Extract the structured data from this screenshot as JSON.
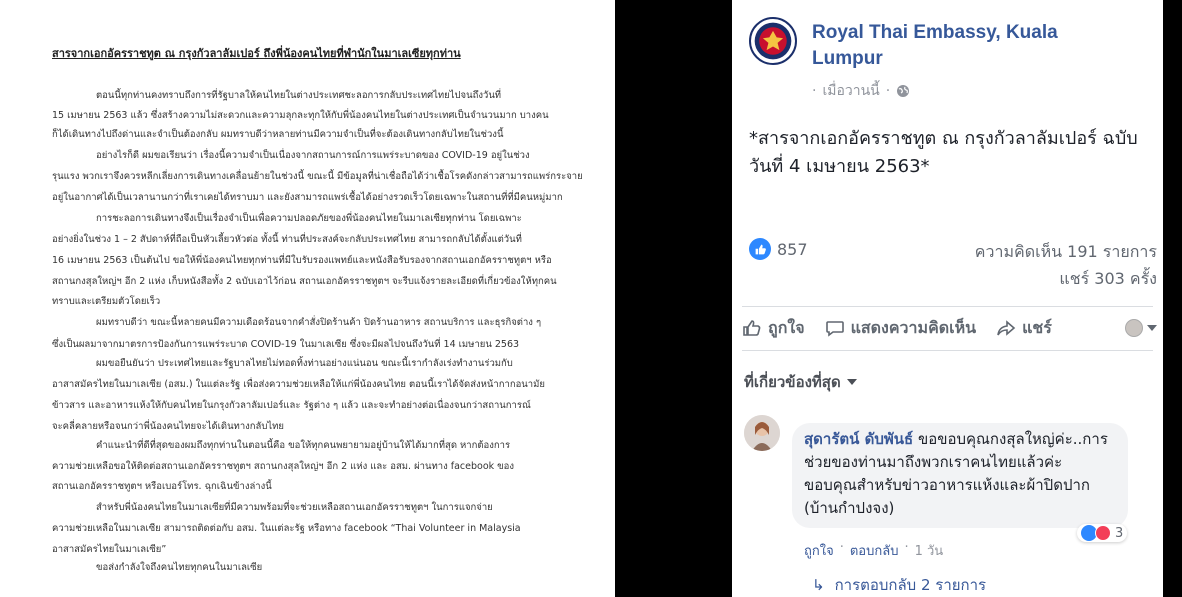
{
  "document": {
    "title": "สารจากเอกอัครราชทูต ณ กรุงกัวลาลัมเปอร์ ถึงพี่น้องคนไทยที่พำนักในมาเลเซียทุกท่าน",
    "lines": [
      "ตอนนี้ทุกท่านคงทราบถึงการที่รัฐบาลให้คนไทยในต่างประเทศชะลอการกลับประเทศไทยไปจนถึงวันที่",
      "15 เมษายน 2563 แล้ว ซึ่งสร้างความไม่สะดวกและความลุกละทุกให้กับพี่น้องคนไทยในต่างประเทศเป็นจำนวนมาก บางคน",
      "ก็ได้เดินทางไปถึงด่านและจำเป็นต้องกลับ ผมทราบดีว่าหลายท่านมีความจำเป็นที่จะต้องเดินทางกลับไทยในช่วงนี้",
      "อย่างไรก็ดี ผมขอเรียนว่า เรื่องนี้ความจำเป็นเนื่องจากสถานการณ์การแพร่ระบาดของ COVID-19 อยู่ในช่วง",
      "รุนแรง พวกเราจึงควรหลีกเลี่ยงการเดินทางเคลื่อนย้ายในช่วงนี้ ขณะนี้ มีข้อมูลที่น่าเชื่อถือได้ว่าเชื้อโรคดังกล่าวสามารถแพร่กระจาย",
      "อยู่ในอากาศได้เป็นเวลานานกว่าที่เราเคยได้ทราบมา และยังสามารถแพร่เชื้อได้อย่างรวดเร็วโดยเฉพาะในสถานที่ที่มีคนหมู่มาก",
      "การชะลอการเดินทางจึงเป็นเรื่องจำเป็นเพื่อความปลอดภัยของพี่น้องคนไทยในมาเลเซียทุกท่าน โดยเฉพาะ",
      "อย่างยิ่งในช่วง 1 – 2 สัปดาห์ที่ถือเป็นหัวเลี้ยวหัวต่อ ทั้งนี้ ท่านที่ประสงค์จะกลับประเทศไทย สามารถกลับได้ตั้งแต่วันที่",
      "16 เมษายน 2563 เป็นต้นไป ขอให้พี่น้องคนไทยทุกท่านที่มีใบรับรองแพทย์และหนังสือรับรองจากสถานเอกอัครราชทูตฯ หรือ",
      "สถานกงสุลใหญ่ฯ อีก 2 แห่ง เก็บหนังสือทั้ง 2 ฉบับเอาไว้ก่อน สถานเอกอัครราชทูตฯ จะรีบแจ้งรายละเอียดที่เกี่ยวข้องให้ทุกคน",
      "ทราบและเตรียมตัวโดยเร็ว",
      "ผมทราบดีว่า ขณะนี้หลายคนมีความเดือดร้อนจากคำสั่งปิดร้านค้า ปิดร้านอาหาร สถานบริการ และธุรกิจต่าง ๆ",
      "ซึ่งเป็นผลมาจากมาตรการป้องกันการแพร่ระบาด COVID-19 ในมาเลเซีย ซึ่งจะมีผลไปจนถึงวันที่ 14 เมษายน 2563",
      "ผมขอยืนยันว่า ประเทศไทยและรัฐบาลไทยไม่ทอดทิ้งท่านอย่างแน่นอน ขณะนี้เรากำลังเร่งทำงานร่วมกับ",
      "อาสาสมัครไทยในมาเลเซีย (อสม.) ในแต่ละรัฐ เพื่อส่งความช่วยเหลือให้แก่พี่น้องคนไทย ตอนนี้เราได้จัดส่งหน้ากากอนามัย",
      "ข้าวสาร และอาหารแห้งให้กับคนไทยในกรุงกัวลาลัมเปอร์และ รัฐต่าง ๆ แล้ว และจะทำอย่างต่อเนื่องจนกว่าสถานการณ์",
      "จะคลี่คลายหรือจนกว่าพี่น้องคนไทยจะได้เดินทางกลับไทย",
      "คำแนะนำที่ดีที่สุดของผมถึงทุกท่านในตอนนี้คือ ขอให้ทุกคนพยายามอยู่บ้านให้ได้มากที่สุด หากต้องการ",
      "ความช่วยเหลือขอให้ติดต่อสถานเอกอัครราชทูตฯ สถานกงสุลใหญ่ฯ อีก 2 แห่ง และ อสม. ผ่านทาง facebook ของ",
      "สถานเอกอัครราชทูตฯ หรือเบอร์โทร. ฉุกเฉินข้างล่างนี้",
      "สำหรับพี่น้องคนไทยในมาเลเซียที่มีความพร้อมที่จะช่วยเหลือสถานเอกอัครราชทูตฯ ในการแจกจ่าย",
      "ความช่วยเหลือในมาเลเซีย สามารถติดต่อกับ อสม. ในแต่ละรัฐ หรือทาง facebook “Thai Volunteer in Malaysia",
      "อาสาสมัครไทยในมาเลเซีย”",
      "ขอส่งกำลังใจถึงคนไทยทุกคนในมาเลเซีย"
    ]
  },
  "post": {
    "page_name": "Royal Thai Embassy, Kuala Lumpur",
    "time": "เมื่อวานนี้",
    "separator": "·",
    "text": "*สารจากเอกอัครราชทูต ณ กรุงกัวลาลัมเปอร์ ฉบับวันที่ 4 เมษายน 2563*",
    "like_count": "857",
    "comments_count": "ความคิดเห็น 191 รายการ",
    "shares_count": "แชร์ 303 ครั้ง",
    "actions": {
      "like": "ถูกใจ",
      "comment": "แสดงความคิดเห็น",
      "share": "แชร์"
    },
    "sort_label": "ที่เกี่ยวข้องที่สุด"
  },
  "comment": {
    "author": "สุดารัตน์ ดับพันธ์",
    "text": "ขอขอบคุณกงสุลใหญ่ค่ะ..การช่วยของท่านมาถึงพวกเราคนไทยแล้วค่ะ",
    "text2": "ขอบคุณสำหรับข่าวอาหารแห้งและผ้าปิดปาก (บ้านกำปงจง)",
    "reaction_count": "3",
    "like": "ถูกใจ",
    "reply": "ตอบกลับ",
    "time": "1 วัน",
    "dot": "·",
    "replies": "การตอบกลับ 2 รายการ",
    "reply_arrow": "↳"
  },
  "colors": {
    "link": "#365899",
    "like_blue": "#2d88ff",
    "love_red": "#f33e58"
  }
}
